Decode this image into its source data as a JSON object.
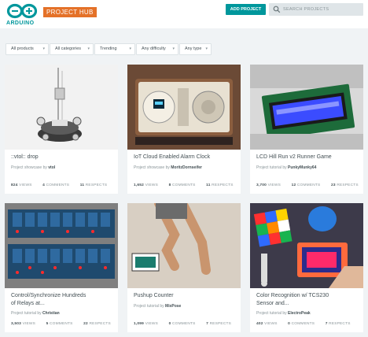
{
  "header": {
    "logo_text": "ARDUINO",
    "hub_badge": "PROJECT HUB",
    "add_project": "ADD PROJECT",
    "search_placeholder": "SEARCH PROJECTS"
  },
  "filters": [
    {
      "label": "All products"
    },
    {
      "label": "All categories"
    },
    {
      "label": "Trending"
    },
    {
      "label": "Any difficulty"
    },
    {
      "label": "Any type"
    }
  ],
  "cards": [
    {
      "title": "::vtol:: drop",
      "type": "Project showcase by",
      "author": "vtol",
      "views": "824",
      "views_label": "VIEWS",
      "comments": "4",
      "comments_label": "COMMENTS",
      "respects": "11",
      "respects_label": "RESPECTS"
    },
    {
      "title": "IoT Cloud Enabled Alarm Clock",
      "type": "Project showcase by",
      "author": "MoritzDornseifer",
      "views": "1,652",
      "views_label": "VIEWS",
      "comments": "8",
      "comments_label": "COMMENTS",
      "respects": "11",
      "respects_label": "RESPECTS"
    },
    {
      "title": "LCD Hill Run v2 Runner Game",
      "type": "Project tutorial by",
      "author": "PunkyMunky64",
      "views": "3,700",
      "views_label": "VIEWS",
      "comments": "12",
      "comments_label": "COMMENTS",
      "respects": "23",
      "respects_label": "RESPECTS"
    },
    {
      "title_line1": "Control/Synchronize Hundreds",
      "title_line2": "of Relays at...",
      "type": "Project tutorial by",
      "author": "Christian",
      "views": "3,503",
      "views_label": "VIEWS",
      "comments": "5",
      "comments_label": "COMMENTS",
      "respects": "22",
      "respects_label": "RESPECTS"
    },
    {
      "title": "Pushup Counter",
      "type": "Project tutorial by",
      "author": "MixPose",
      "views": "1,099",
      "views_label": "VIEWS",
      "comments": "0",
      "comments_label": "COMMENTS",
      "respects": "7",
      "respects_label": "RESPECTS"
    },
    {
      "title_line1": "Color Recognition w/ TCS230",
      "title_line2": "Sensor and...",
      "type": "Project tutorial by",
      "author": "ElectroPeak",
      "views": "402",
      "views_label": "VIEWS",
      "comments": "0",
      "comments_label": "COMMENTS",
      "respects": "7",
      "respects_label": "RESPECTS"
    }
  ],
  "colors": {
    "teal": "#00979c",
    "orange": "#e47128",
    "background": "#f0f3f5"
  }
}
